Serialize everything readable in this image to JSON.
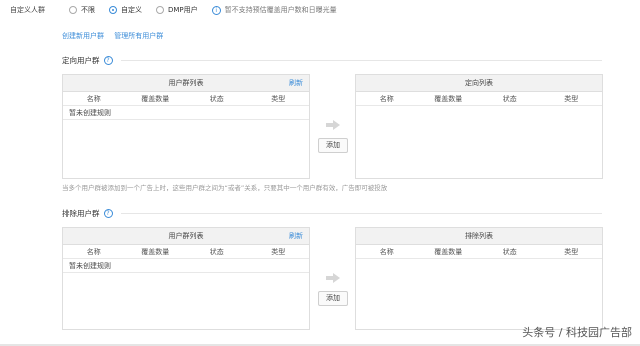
{
  "audience": {
    "label": "自定义人群",
    "options": [
      {
        "label": "不限",
        "checked": false
      },
      {
        "label": "自定义",
        "checked": true
      },
      {
        "label": "DMP用户",
        "checked": false
      }
    ],
    "info": "暂不支持预估覆盖用户数和日曝光量"
  },
  "links": {
    "create": "创建新用户群",
    "manage": "管理所有用户群"
  },
  "targeting": {
    "title": "定向用户群",
    "left_panel": {
      "header": "用户群列表",
      "refresh": "刷新",
      "columns": [
        "名称",
        "覆盖数量",
        "状态",
        "类型"
      ],
      "empty": "暂未创建规则"
    },
    "add_button": "添加",
    "right_panel": {
      "header": "定向列表",
      "columns": [
        "名称",
        "覆盖数量",
        "状态",
        "类型"
      ]
    },
    "note": "当多个用户群被添加到一个广告上时，这些用户群之间为“或者”关系，只要其中一个用户群有效，广告即可被投放"
  },
  "exclusion": {
    "title": "排除用户群",
    "left_panel": {
      "header": "用户群列表",
      "refresh": "刷新",
      "columns": [
        "名称",
        "覆盖数量",
        "状态",
        "类型"
      ],
      "empty": "暂未创建规则"
    },
    "add_button": "添加",
    "right_panel": {
      "header": "排除列表",
      "columns": [
        "名称",
        "覆盖数量",
        "状态",
        "类型"
      ]
    }
  },
  "watermark": "头条号 / 科技园广告部",
  "colors": {
    "accent": "#3b8cd8",
    "header_bg": "#f2f2f2",
    "border": "#dedede"
  }
}
